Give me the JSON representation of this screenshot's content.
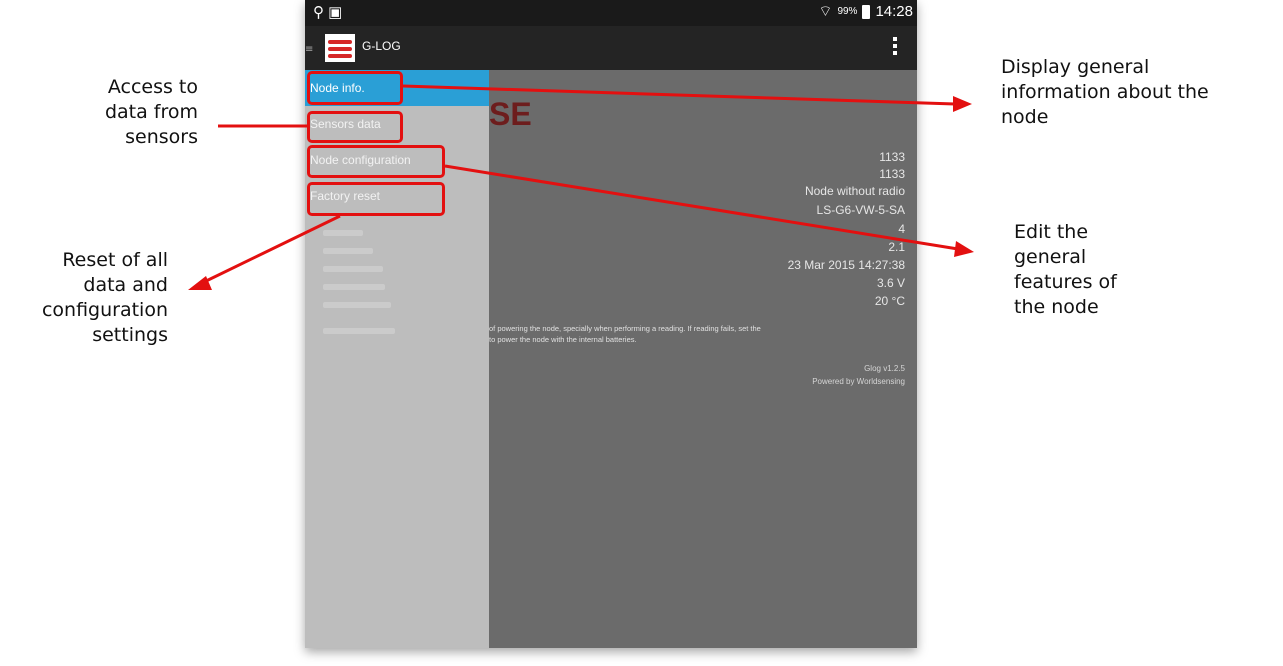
{
  "annotations": {
    "access_sensors": [
      "Access to",
      "data from",
      "sensors"
    ],
    "reset": [
      "Reset of all",
      "data and",
      "configuration",
      "settings"
    ],
    "node_info": [
      "Display general",
      "information about the",
      "node"
    ],
    "node_config": [
      "Edit the",
      "general",
      "features of",
      "the node"
    ]
  },
  "status_bar": {
    "battery": "99%",
    "time": "14:28"
  },
  "app_bar": {
    "title": "G-LOG"
  },
  "drawer": {
    "items": [
      {
        "label": "Node info.",
        "active": true
      },
      {
        "label": "Sensors data",
        "active": false
      },
      {
        "label": "Node configuration",
        "active": false
      },
      {
        "label": "Factory reset",
        "active": false
      }
    ]
  },
  "content": {
    "brand": "SE",
    "info_values": [
      "1133",
      "1133",
      "Node without radio",
      "LS-G6-VW-5-SA",
      "4",
      "2.1",
      "23 Mar 2015 14:27:38",
      "3.6 V",
      "20 °C"
    ],
    "description": [
      "of powering the node, specially when performing a reading. If reading fails, set the",
      "to power the node with the internal batteries."
    ],
    "version": "Glog v1.2.5",
    "powered_by": "Powered by Worldsensing"
  },
  "colors": {
    "accent": "#2a9fd6",
    "callout": "#e31010",
    "brand_red": "#d62828"
  }
}
